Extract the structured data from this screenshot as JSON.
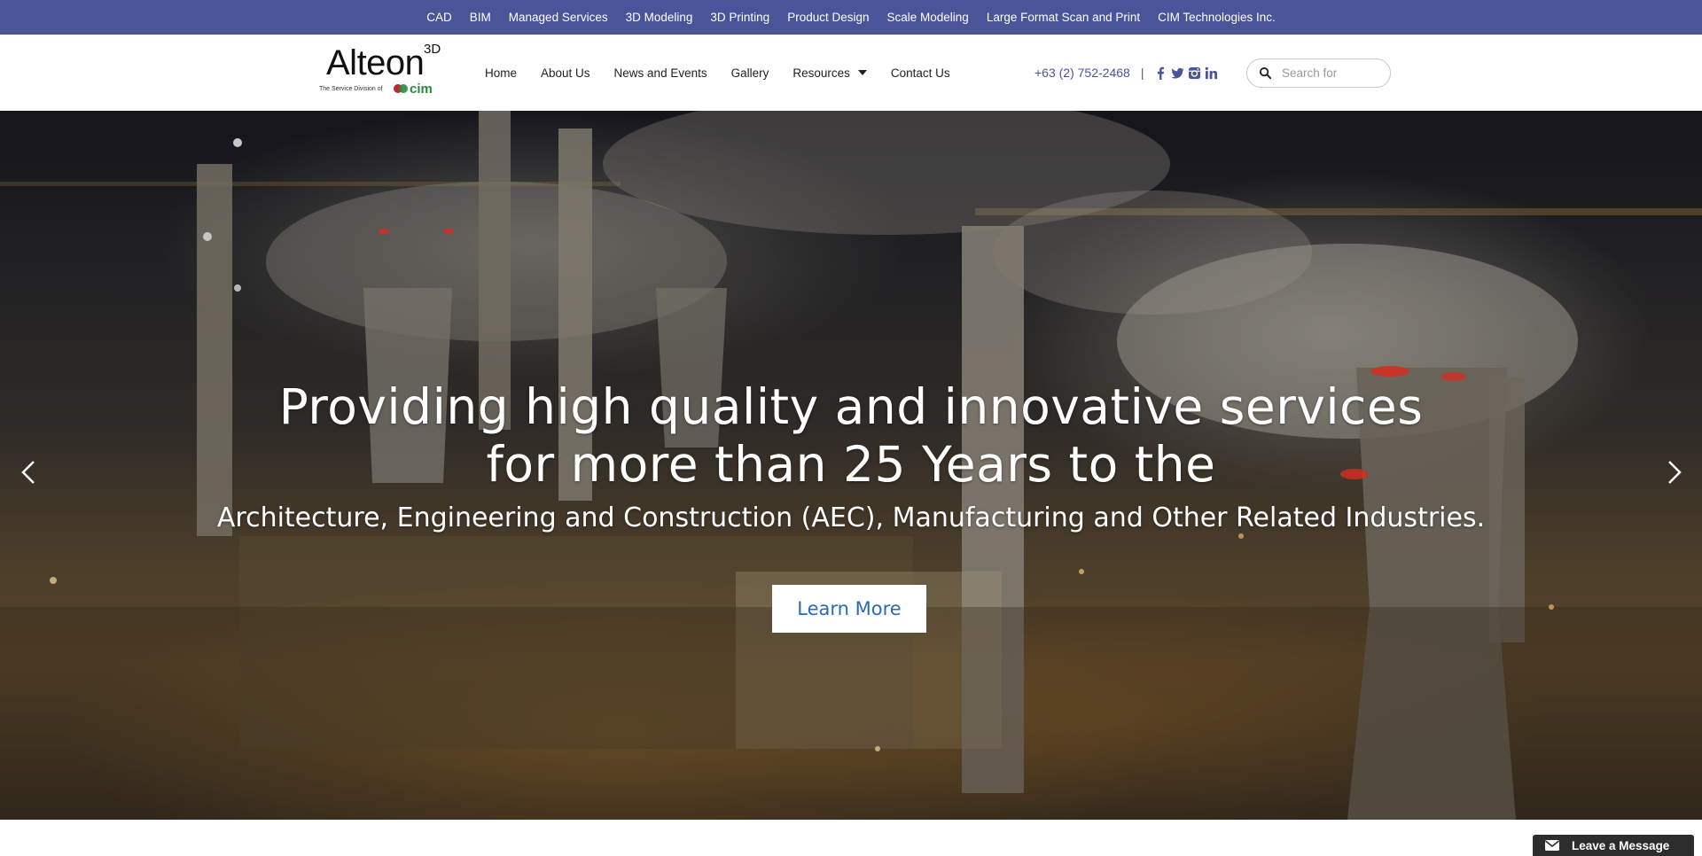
{
  "topbar": {
    "links": [
      "CAD",
      "BIM",
      "Managed Services",
      "3D Modeling",
      "3D Printing",
      "Product Design",
      "Scale Modeling",
      "Large Format Scan and Print",
      "CIM Technologies Inc."
    ]
  },
  "logo": {
    "wordmark": "Alteon",
    "superscript": "3D",
    "tagline": "The Service Division of",
    "partner": "cim"
  },
  "nav": {
    "items": [
      "Home",
      "About Us",
      "News and Events",
      "Gallery",
      "Resources",
      "Contact Us"
    ]
  },
  "contact": {
    "phone": "+63 (2) 752-2468",
    "separator": "|",
    "social_icons": [
      "facebook-icon",
      "twitter-icon",
      "instagram-icon",
      "linkedin-icon"
    ]
  },
  "search": {
    "placeholder": "Search for"
  },
  "hero": {
    "title_line1": "Providing high quality and innovative services",
    "title_line2": "for more than 25 Years to the",
    "subtitle": "Architecture, Engineering and Construction (AEC), Manufacturing and Other Related Industries.",
    "button_label": "Learn More"
  },
  "chat": {
    "label": "Leave a Message"
  },
  "colors": {
    "topbar_bg": "#4a5499",
    "accent_text": "#4a5499",
    "button_text": "#2a6ab7",
    "chat_bg": "#2d2d2d"
  }
}
